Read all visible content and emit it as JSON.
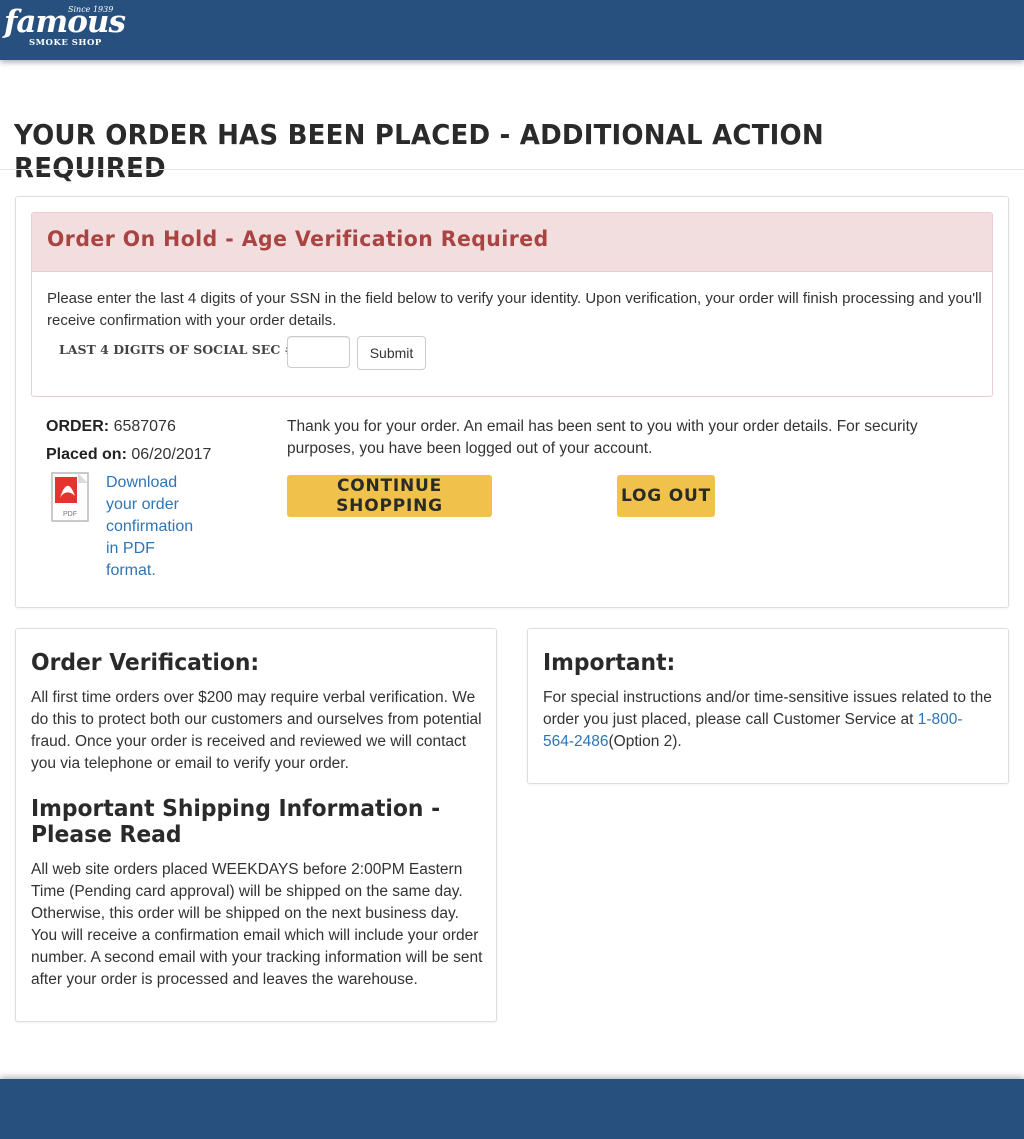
{
  "header": {
    "logo_brand": "famous",
    "logo_since": "Since 1939",
    "logo_sub": "SMOKE SHOP"
  },
  "page_title": "YOUR ORDER HAS BEEN PLACED - ADDITIONAL ACTION REQUIRED",
  "hold": {
    "title": "Order On Hold - Age Verification Required",
    "message": "Please enter the last 4 digits of your SSN in the field below to verify your identity. Upon verification, your order will finish processing and you'll receive confirmation with your order details.",
    "ssn_label": "LAST 4 DIGITS OF SOCIAL SEC #",
    "ssn_value": "",
    "submit_label": "Submit"
  },
  "order": {
    "order_label": "ORDER:",
    "order_number": "6587076",
    "placed_label": "Placed on:",
    "placed_date": "06/20/2017",
    "pdf_link": "Download your order confirmation in PDF format.",
    "pdf_icon_text": "PDF",
    "thanks": "Thank you for your order. An email has been sent to you with your order details. For security purposes, you have been logged out of your account.",
    "continue_label": "CONTINUE SHOPPING",
    "logout_label": "LOG OUT"
  },
  "verification": {
    "heading": "Order Verification:",
    "text": "All first time orders over $200 may require verbal verification. We do this to protect both our customers and ourselves from potential fraud. Once your order is received and reviewed we will contact you via telephone or email to verify your order."
  },
  "shipping": {
    "heading": "Important Shipping Information - Please Read",
    "text": "All web site orders placed WEEKDAYS before 2:00PM Eastern Time (Pending card approval) will be shipped on the same day. Otherwise, this order will be shipped on the next business day. You will receive a confirmation email which will include your order number. A second email with your tracking information will be sent after your order is processed and leaves the warehouse."
  },
  "important": {
    "heading": "Important:",
    "text_before": "For special instructions and/or time-sensitive issues related to the order you just placed, please call Customer Service at ",
    "phone": "1-800-564-2486",
    "text_after": "(Option 2)."
  },
  "colors": {
    "brand_blue": "#27507f",
    "button_yellow": "#f0c24b",
    "alert_red": "#a94442",
    "alert_bg": "#f2dede",
    "link_blue": "#2f74b5"
  }
}
